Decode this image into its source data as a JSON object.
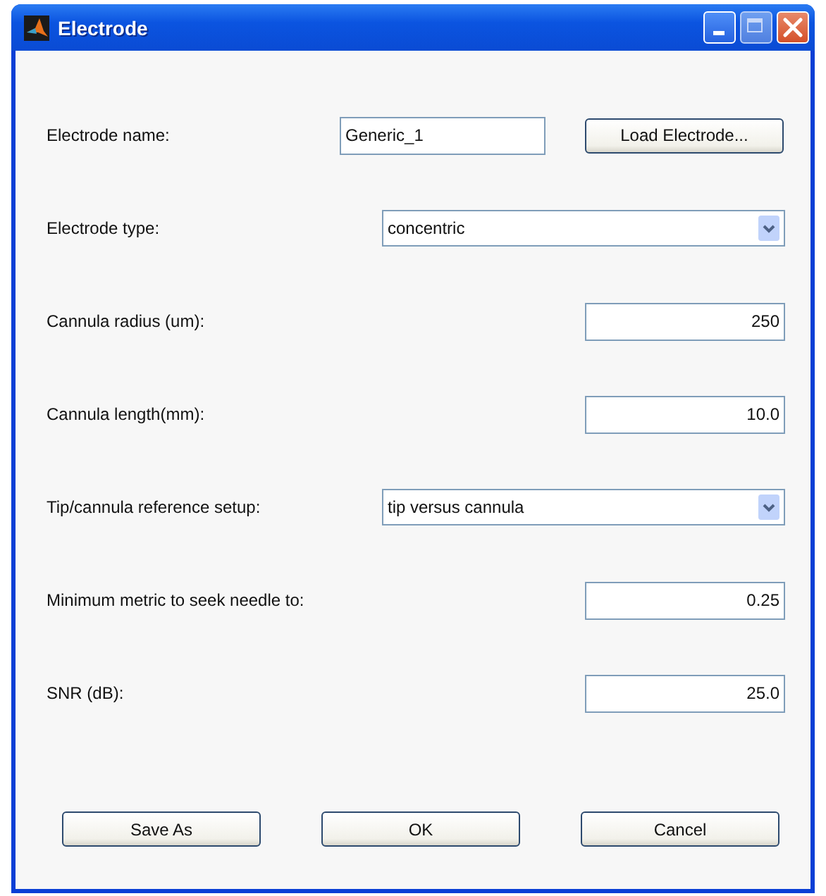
{
  "window": {
    "title": "Electrode"
  },
  "rows": [
    {
      "label": "Electrode name:",
      "kind": "text",
      "value": "Generic_1",
      "button": "Load Electrode..."
    },
    {
      "label": "Electrode type:",
      "kind": "select",
      "value": "concentric"
    },
    {
      "label": "Cannula radius (um):",
      "kind": "number",
      "value": "250"
    },
    {
      "label": "Cannula length(mm):",
      "kind": "number",
      "value": "10.0"
    },
    {
      "label": "Tip/cannula reference setup:",
      "kind": "select",
      "value": "tip versus cannula"
    },
    {
      "label": "Minimum metric to seek needle to:",
      "kind": "number",
      "value": "0.25"
    },
    {
      "label": "SNR (dB):",
      "kind": "number",
      "value": "25.0"
    }
  ],
  "buttons": [
    "Save As",
    "OK",
    "Cancel"
  ]
}
